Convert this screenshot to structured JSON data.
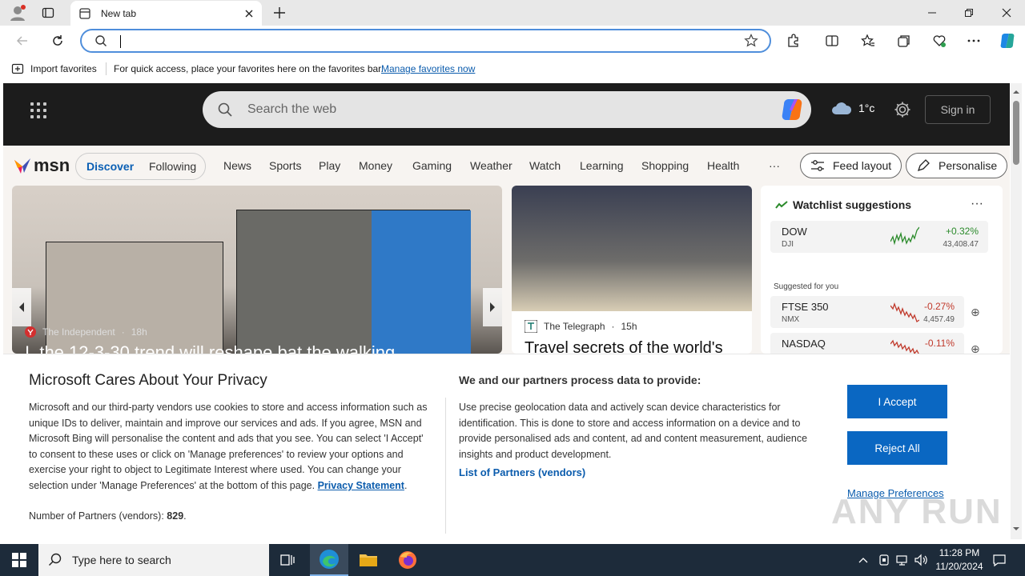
{
  "browser": {
    "tab_title": "New tab",
    "address_value": "",
    "favorites_bar": {
      "import_label": "Import favorites",
      "message": "For quick access, place your favorites here on the favorites bar.",
      "manage_link": "Manage favorites now"
    }
  },
  "msn": {
    "search_placeholder": "Search the web",
    "weather_temp": "1°c",
    "sign_in": "Sign in",
    "logo_text": "msn",
    "toggle": {
      "active": "Discover",
      "inactive": "Following"
    },
    "categories": [
      "News",
      "Sports",
      "Play",
      "Money",
      "Gaming",
      "Weather",
      "Watch",
      "Learning",
      "Shopping",
      "Health"
    ],
    "more": "···",
    "feed_layout": "Feed layout",
    "personalise": "Personalise",
    "hero": {
      "source": "The Independent",
      "age": "18h",
      "headline": "I, the 12-3-30 trend will reshape bat the walking"
    },
    "card2": {
      "source": "The Telegraph",
      "age": "15h",
      "headline": "Travel secrets of the world's"
    },
    "watchlist": {
      "title": "Watchlist suggestions",
      "more": "···",
      "suggested_label": "Suggested for you",
      "stocks": [
        {
          "symbol": "DOW",
          "exchange": "DJI",
          "change": "+0.32%",
          "value": "43,408.47",
          "color": "#2a8a2a"
        },
        {
          "symbol": "FTSE 350",
          "exchange": "NMX",
          "change": "-0.27%",
          "value": "4,457.49",
          "color": "#c0392b"
        },
        {
          "symbol": "NASDAQ",
          "exchange": "",
          "change": "-0.11%",
          "value": "",
          "color": "#c0392b"
        }
      ]
    }
  },
  "privacy": {
    "title": "Microsoft Cares About Your Privacy",
    "body": "Microsoft and our third-party vendors use cookies to store and access information such as unique IDs to deliver, maintain and improve our services and ads. If you agree, MSN and Microsoft Bing will personalise the content and ads that you see. You can select 'I Accept' to consent to these uses or click on 'Manage preferences' to review your options and exercise your right to object to Legitimate Interest where used.  You can change your selection under 'Manage Preferences' at the bottom of this page.",
    "privacy_link": "Privacy Statement",
    "partners_label": "Number of Partners (vendors):",
    "partners_count": "829",
    "right_title": "We and our partners process data to provide:",
    "right_body": "Use precise geolocation data and actively scan device characteristics for identification. This is done to store and access information on a device and to provide personalised ads and content, ad and content measurement, audience insights and product development.",
    "partners_link": "List of Partners (vendors)",
    "accept": "I Accept",
    "reject": "Reject All",
    "manage": "Manage Preferences",
    "watermark": "ANY RUN"
  },
  "taskbar": {
    "search_placeholder": "Type here to search",
    "time": "11:28 PM",
    "date": "11/20/2024"
  }
}
